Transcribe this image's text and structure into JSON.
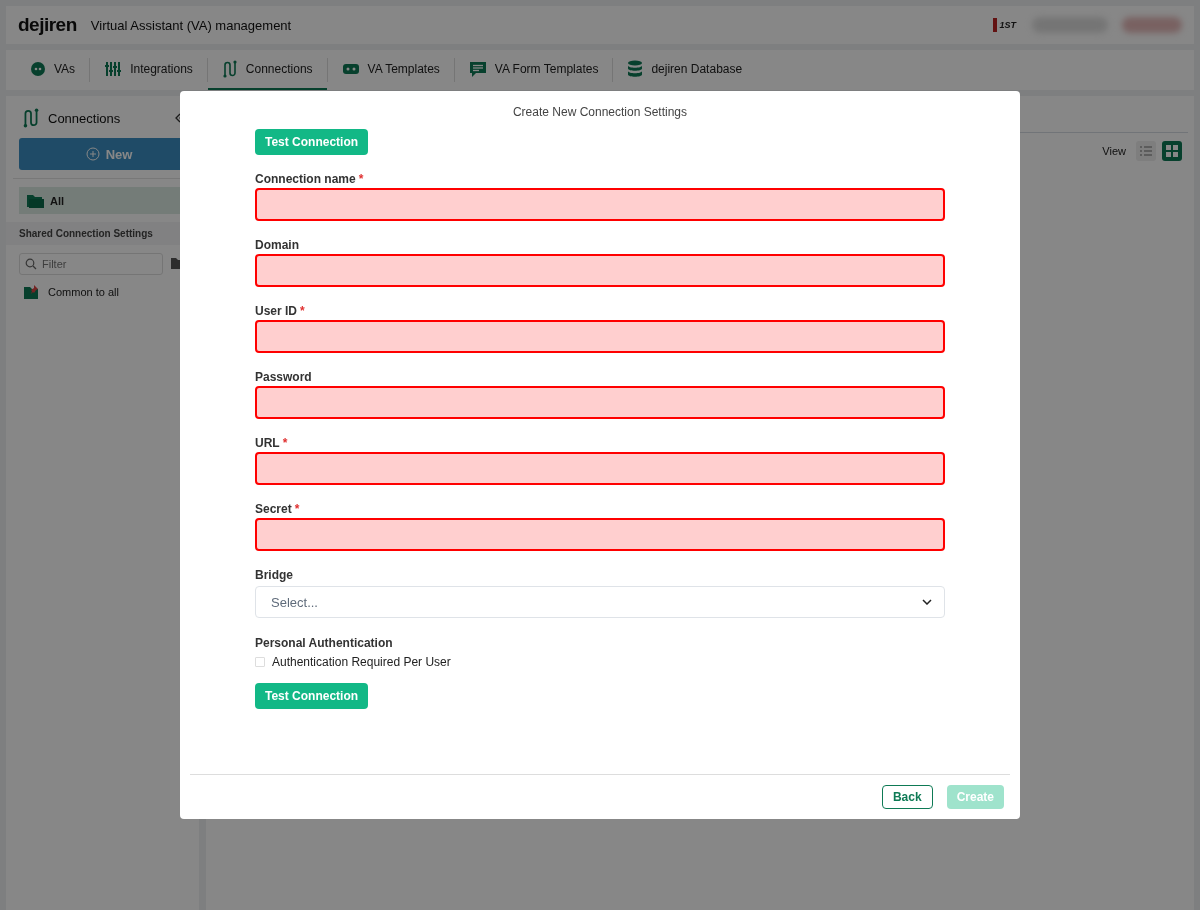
{
  "header": {
    "brand": "dejiren",
    "app_title": "Virtual Assistant (VA) management",
    "org_logo": "1ST"
  },
  "tabs": [
    {
      "label": "VAs",
      "selected": false
    },
    {
      "label": "Integrations",
      "selected": false
    },
    {
      "label": "Connections",
      "selected": true
    },
    {
      "label": "VA Templates",
      "selected": false
    },
    {
      "label": "VA Form Templates",
      "selected": false
    },
    {
      "label": "dejiren Database",
      "selected": false
    }
  ],
  "sidebar": {
    "title": "Connections",
    "new_button": "New",
    "folders": [
      {
        "label": "All",
        "selected": true
      }
    ],
    "section_title": "Shared Connection Settings",
    "filter": {
      "placeholder": "Filter"
    },
    "items": [
      {
        "label": "Common to all"
      }
    ]
  },
  "main": {
    "view_label": "View",
    "view_modes": [
      {
        "kind": "list",
        "selected": false
      },
      {
        "kind": "grid",
        "selected": true
      }
    ]
  },
  "modal": {
    "title": "Create New Connection Settings",
    "test_button_top": "Test Connection",
    "fields": [
      {
        "label": "Connection name",
        "required_mark": "*",
        "invalid": true
      },
      {
        "label": "Domain",
        "invalid": true
      },
      {
        "label": "User ID",
        "required_mark": "*",
        "invalid": true
      },
      {
        "label": "Password",
        "invalid": true
      },
      {
        "label": "URL",
        "required_mark": "*",
        "invalid": true
      },
      {
        "label": "Secret",
        "required_mark": "*",
        "invalid": true
      }
    ],
    "bridge": {
      "label": "Bridge",
      "placeholder": "Select..."
    },
    "personal_auth": {
      "label": "Personal Authentication",
      "checkbox": {
        "label": "Authentication Required Per User",
        "checked": false
      }
    },
    "test_button_bottom": "Test Connection",
    "back_button": "Back",
    "create_button": {
      "label": "Create",
      "disabled": true
    }
  }
}
